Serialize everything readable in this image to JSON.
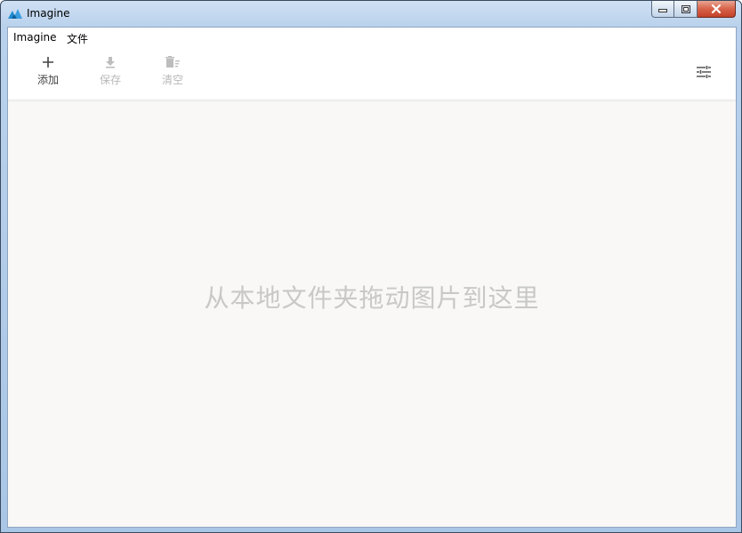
{
  "window": {
    "title": "Imagine"
  },
  "menu": {
    "items": [
      {
        "label": "Imagine"
      },
      {
        "label": "文件"
      }
    ]
  },
  "toolbar": {
    "add_label": "添加",
    "save_label": "保存",
    "clear_label": "清空",
    "icons": {
      "add": "plus-icon",
      "save": "download-icon",
      "clear": "clear-list-icon",
      "settings": "sliders-icon"
    }
  },
  "main": {
    "drop_hint": "从本地文件夹拖动图片到这里"
  },
  "colors": {
    "app_icon": "#1e8bd0",
    "text_enabled": "#444444",
    "text_disabled": "#b8b8b8",
    "drop_hint": "#c8c8c8",
    "background": "#f9f8f6"
  }
}
